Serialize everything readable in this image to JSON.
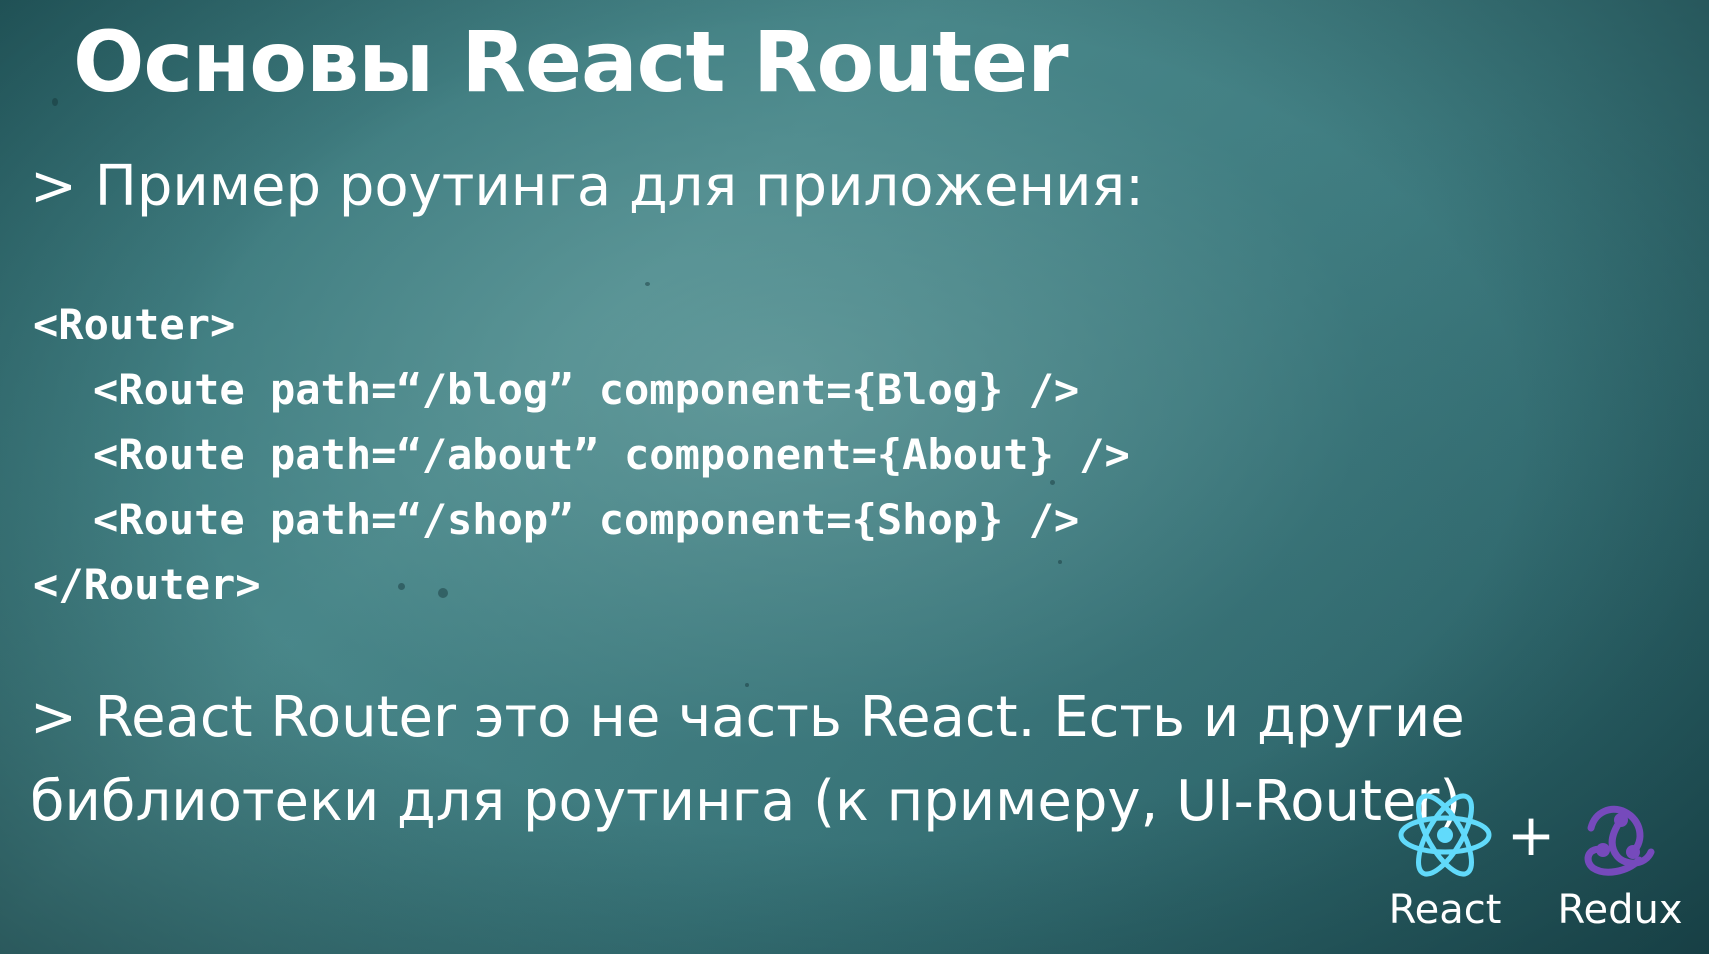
{
  "slide": {
    "title": "Основы React Router",
    "bullet1": "> Пример роутинга для приложения:",
    "code_lines": [
      "<Router>",
      "<Route path=“/blog” component={Blog} />",
      "<Route path=“/about” component={About} />",
      "<Route path=“/shop” component={Shop} />",
      "</Router>"
    ],
    "bullet2": "> React Router это не часть React. Есть и другие библиотеки для роутинга (к примеру, UI-Router)"
  },
  "logos": {
    "react_label": "React",
    "plus": "+",
    "redux_label": "Redux",
    "react_icon": "react-atom-icon",
    "redux_icon": "redux-swirl-icon",
    "react_color": "#61dafb",
    "redux_color": "#764abc"
  }
}
